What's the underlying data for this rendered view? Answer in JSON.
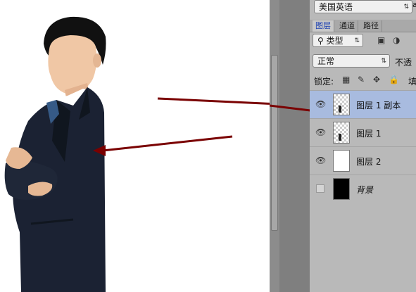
{
  "panel": {
    "language_select": "美国英语",
    "language_select_next": "a",
    "tabs": [
      {
        "label": "图层",
        "active": true
      },
      {
        "label": "通道",
        "active": false
      },
      {
        "label": "路径",
        "active": false
      }
    ],
    "filter": {
      "search_icon": "⚲",
      "kind_label": "类型"
    },
    "blend_mode": "正常",
    "opacity_label": "不透",
    "lock_label": "锁定:",
    "fill_label": "填",
    "layers": [
      {
        "name": "图层 1 副本",
        "visible": true,
        "selected": true,
        "thumb": "checker"
      },
      {
        "name": "图层 1",
        "visible": true,
        "selected": false,
        "thumb": "checker"
      },
      {
        "name": "图层 2",
        "visible": true,
        "selected": false,
        "thumb": "white"
      },
      {
        "name": "背景",
        "visible": false,
        "selected": false,
        "thumb": "black"
      }
    ]
  },
  "colors": {
    "panel_bg": "#b9b9b9",
    "selected_layer": "#a8bbdf",
    "arrow": "#7a0000",
    "suit": "#1b2233"
  }
}
